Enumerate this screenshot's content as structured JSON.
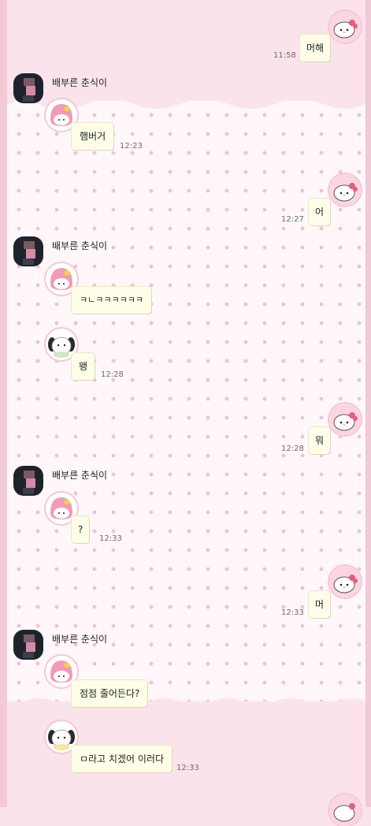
{
  "chat": {
    "sender_name": "배부른 춘식이",
    "messages": [
      {
        "id": "m1",
        "side": "me",
        "text": "머해",
        "time": "11:58"
      },
      {
        "id": "m2",
        "side": "them",
        "text": "햄버거",
        "time": "12:23"
      },
      {
        "id": "m3",
        "side": "me",
        "text": "어",
        "time": "12:27"
      },
      {
        "id": "m4",
        "side": "them",
        "text": "ㅋㄴㅋㅋㅋㅋㅋㅋ",
        "time": ""
      },
      {
        "id": "m5",
        "side": "them",
        "text": "왱",
        "time": "12:28"
      },
      {
        "id": "m6",
        "side": "me",
        "text": "뭐",
        "time": "12:28"
      },
      {
        "id": "m7",
        "side": "them",
        "text": "?",
        "time": "12:33"
      },
      {
        "id": "m8",
        "side": "me",
        "text": "머",
        "time": "12:33"
      },
      {
        "id": "m9",
        "side": "them",
        "text": "점점 줄어든다?",
        "time": ""
      },
      {
        "id": "m10",
        "side": "them",
        "text": "ㅁ라고 치겠어 이러다",
        "time": "12:33"
      }
    ]
  },
  "colors": {
    "background": "#fbe3ec",
    "dot_pattern": "#f1c2d2",
    "bubble": "#fdfde8"
  },
  "icons": {
    "my_profile": "hello-kitty-icon",
    "their_profile": "pixelated-photo-icon",
    "sticker_a": "my-melody-icon",
    "sticker_b": "pochacco-icon"
  }
}
